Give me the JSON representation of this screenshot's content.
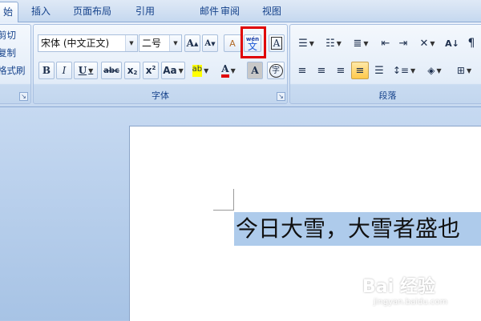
{
  "tabs": [
    {
      "label": "始",
      "active": true
    },
    {
      "label": "插入",
      "active": false
    },
    {
      "label": "页面布局",
      "active": false
    },
    {
      "label": "引用",
      "active": false
    },
    {
      "label": "邮件",
      "active": false
    },
    {
      "label": "审阅",
      "active": false
    },
    {
      "label": "视图",
      "active": false
    }
  ],
  "clipboard": {
    "cut": "剪切",
    "copy": "复制",
    "format_painter": "格式刷"
  },
  "font_group": {
    "label": "字体",
    "font_name": "宋体 (中文正文)",
    "font_size": "二号",
    "grow_font": "A",
    "shrink_font": "A",
    "clear_format": "A",
    "phonetic_guide": "文",
    "phonetic_top": "wén",
    "char_border": "A",
    "bold": "B",
    "italic": "I",
    "underline": "U",
    "strikethrough": "abc",
    "subscript": "x",
    "superscript": "x",
    "change_case": "Aa",
    "highlight": "ab",
    "font_color": "A",
    "char_shading": "A",
    "enclose_char": "字"
  },
  "paragraph_group": {
    "label": "段落"
  },
  "document": {
    "text": "今日大雪，大雪者盛也"
  },
  "watermark": {
    "main": "Bai 经验",
    "sub": "jingyan.baidu.com"
  },
  "colors": {
    "accent_red": "#e00000",
    "selection": "#aecbeb",
    "ribbon_text": "#15428b"
  }
}
